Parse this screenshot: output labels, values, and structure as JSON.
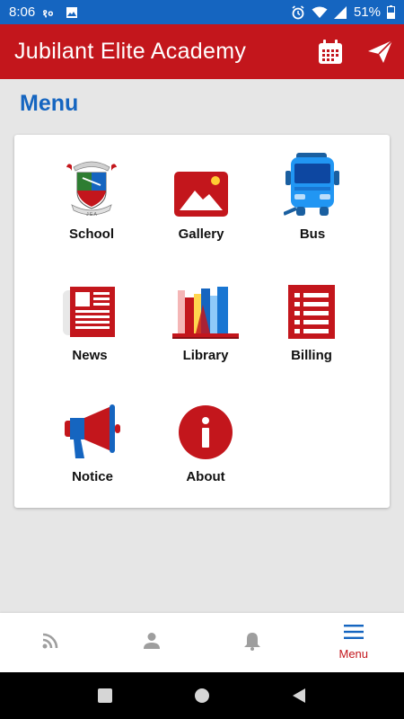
{
  "status_bar": {
    "time": "8:06",
    "battery": "51%"
  },
  "app_bar": {
    "title": "Jubilant Elite Academy",
    "actions": [
      "calendar-icon",
      "send-icon"
    ]
  },
  "page": {
    "title": "Menu"
  },
  "menu": {
    "items": [
      {
        "label": "School",
        "icon": "school-crest-icon"
      },
      {
        "label": "Gallery",
        "icon": "gallery-icon"
      },
      {
        "label": "Bus",
        "icon": "bus-icon"
      },
      {
        "label": "News",
        "icon": "newspaper-icon"
      },
      {
        "label": "Library",
        "icon": "library-books-icon"
      },
      {
        "label": "Billing",
        "icon": "billing-list-icon"
      },
      {
        "label": "Notice",
        "icon": "megaphone-icon"
      },
      {
        "label": "About",
        "icon": "info-icon"
      }
    ]
  },
  "bottom_nav": {
    "items": [
      {
        "icon": "rss-feed-icon",
        "label": ""
      },
      {
        "icon": "person-icon",
        "label": ""
      },
      {
        "icon": "bell-icon",
        "label": ""
      },
      {
        "icon": "menu-icon",
        "label": "Menu",
        "active": true
      }
    ]
  },
  "colors": {
    "primary": "#c3161c",
    "accent": "#1565c0",
    "status_bar": "#1565c0",
    "inactive_icon": "#9e9e9e"
  }
}
